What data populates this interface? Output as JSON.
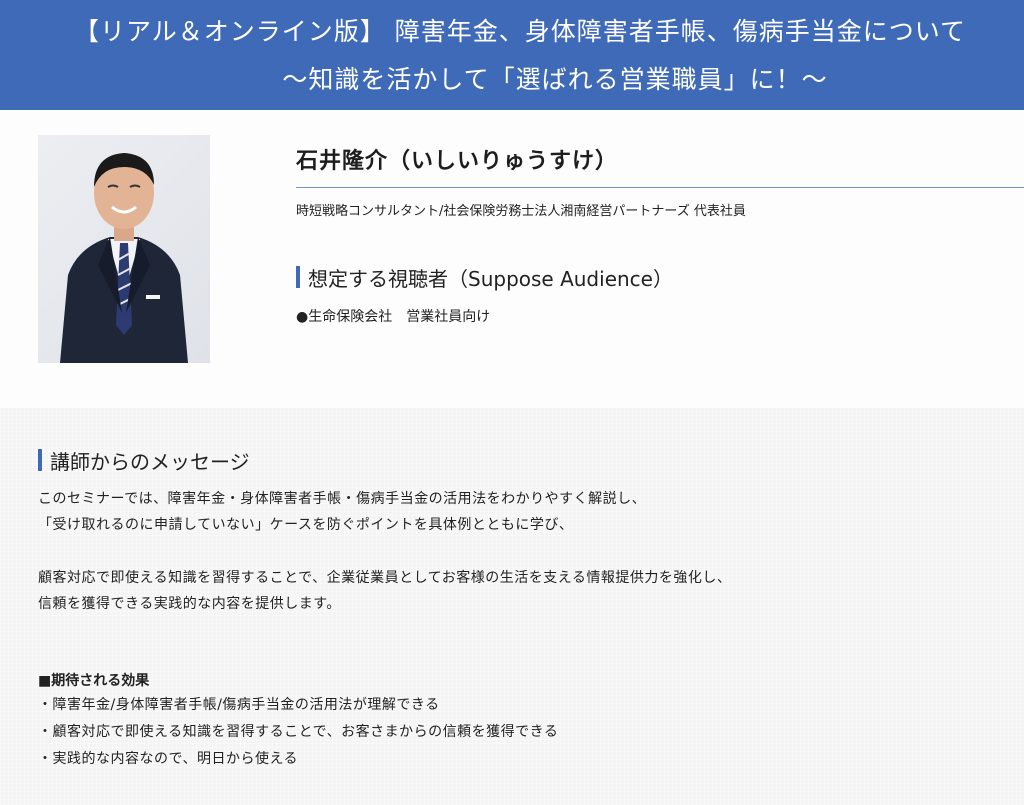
{
  "header": {
    "title_line1": "【リアル＆オンライン版】 障害年金、身体障害者手帳、傷病手当金について",
    "title_line2": "〜知識を活かして「選ばれる営業職員」に！〜"
  },
  "speaker": {
    "name": "石井隆介（いしいりゅうすけ）",
    "title": "時短戦略コンサルタント/社会保険労務士法人湘南経営パートナーズ 代表社員",
    "photo_alt": "speaker-portrait"
  },
  "audience": {
    "heading": "想定する視聴者（Suppose Audience）",
    "text": "●生命保険会社　営業社員向け"
  },
  "message": {
    "heading": "講師からのメッセージ",
    "paragraph1": [
      "このセミナーでは、障害年金・身体障害者手帳・傷病手当金の活用法をわかりやすく解説し、",
      "「受け取れるのに申請していない」ケースを防ぐポイントを具体例とともに学び、"
    ],
    "paragraph2": [
      "顧客対応で即使える知識を習得することで、企業従業員としてお客様の生活を支える情報提供力を強化し、",
      "信頼を獲得できる実践的な内容を提供します。"
    ],
    "effects_title": "■期待される効果",
    "effects": [
      "・障害年金/身体障害者手帳/傷病手当金の活用法が理解できる",
      "・顧客対応で即使える知識を習得することで、お客さまからの信頼を獲得できる",
      "・実践的な内容なので、明日から使える"
    ]
  }
}
